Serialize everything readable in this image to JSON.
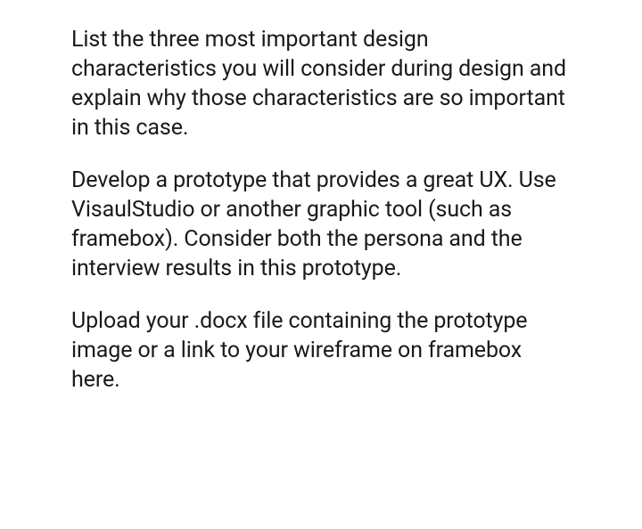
{
  "paragraphs": [
    "List the three most important design characteristics you will consider during design and explain why those characteristics are so important in this case.",
    "Develop a prototype that provides a great UX. Use VisaulStudio or another graphic tool (such as framebox). Consider both the persona and the interview results in this prototype.",
    "Upload your .docx file containing the prototype image or a link to your wireframe on framebox here."
  ]
}
